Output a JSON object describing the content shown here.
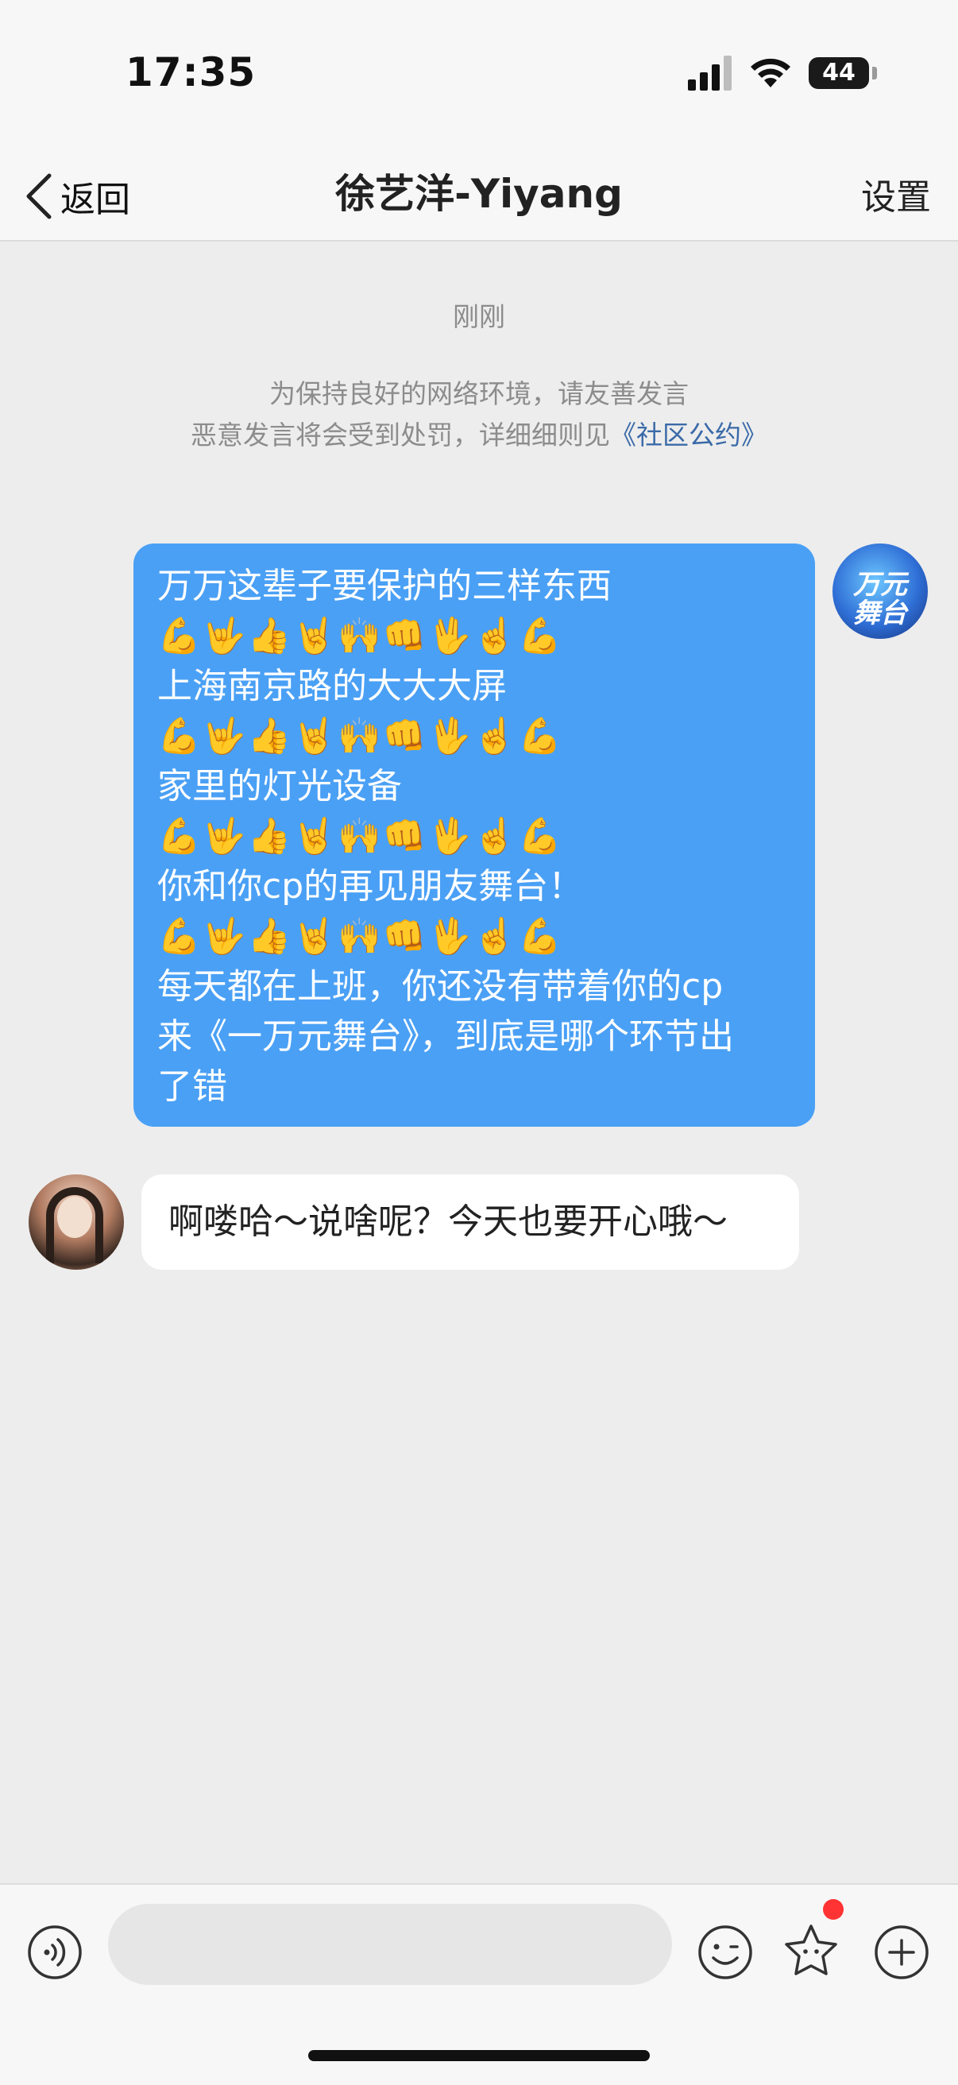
{
  "status_bar": {
    "time": "17:35",
    "battery": "44"
  },
  "nav": {
    "back_label": "返回",
    "title": "徐艺洋-Yiyang",
    "settings_label": "设置"
  },
  "chat": {
    "timestamp": "刚刚",
    "notice_line1": "为保持良好的网络环境，请友善发言",
    "notice_line2_prefix": "恶意发言将会受到处罚，详细细则见",
    "notice_link": "《社区公约》",
    "outgoing_lines": [
      "万万这辈子要保护的三样东西",
      "💪🤟👍🤘🙌👊🖖☝️💪",
      "上海南京路的大大大屏",
      "💪🤟👍🤘🙌👊🖖☝️💪",
      "家里的灯光设备",
      "💪🤟👍🤘🙌👊🖖☝️💪",
      "你和你cp的再见朋友舞台！",
      "💪🤟👍🤘🙌👊🖖☝️💪",
      "每天都在上班，你还没有带着你的cp",
      "来《一万元舞台》，到底是哪个环节出",
      "了错"
    ],
    "outgoing_avatar_text": "万元舞台",
    "incoming_text": "啊喽哈～说啥呢？今天也要开心哦～"
  },
  "input_bar": {
    "placeholder": ""
  }
}
